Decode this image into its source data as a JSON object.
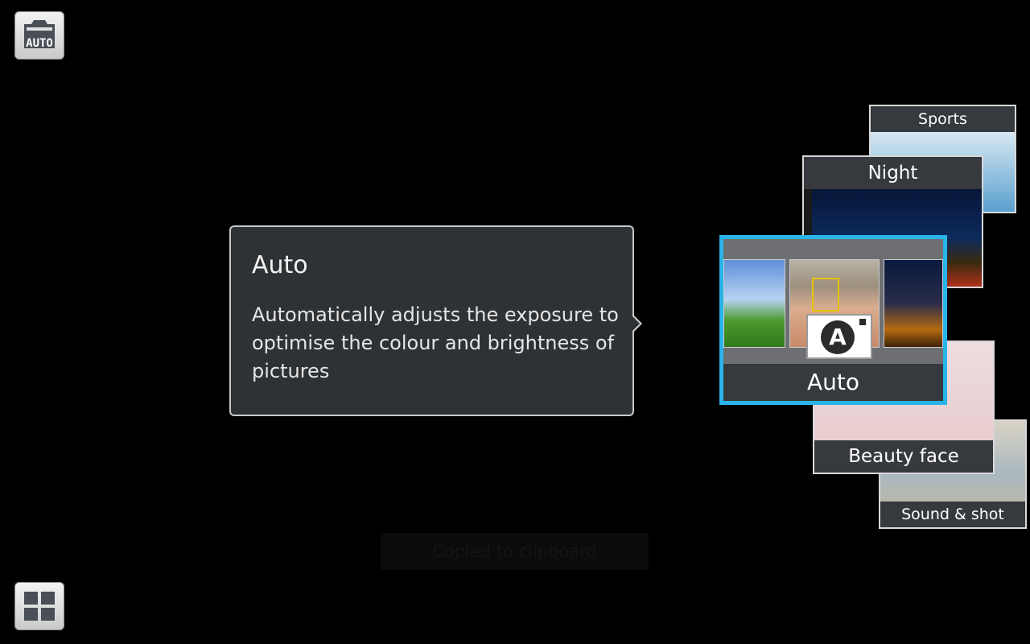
{
  "camera": {
    "mode_button_label": "AUTO"
  },
  "tooltip": {
    "title": "Auto",
    "description": "Automatically adjusts the exposure to optimise the colour and brightness of pictures"
  },
  "modes": {
    "sports": "Sports",
    "night": "Night",
    "auto": "Auto",
    "beauty_face": "Beauty face",
    "sound_and_shot": "Sound & shot"
  },
  "toast": "Copied to clipboard",
  "colors": {
    "selected_border": "#29b4ea",
    "panel_bg": "#2f3235",
    "label_bg": "#36393d"
  },
  "icons": {
    "mode": "camera-auto-icon",
    "grid": "grid-icon"
  }
}
